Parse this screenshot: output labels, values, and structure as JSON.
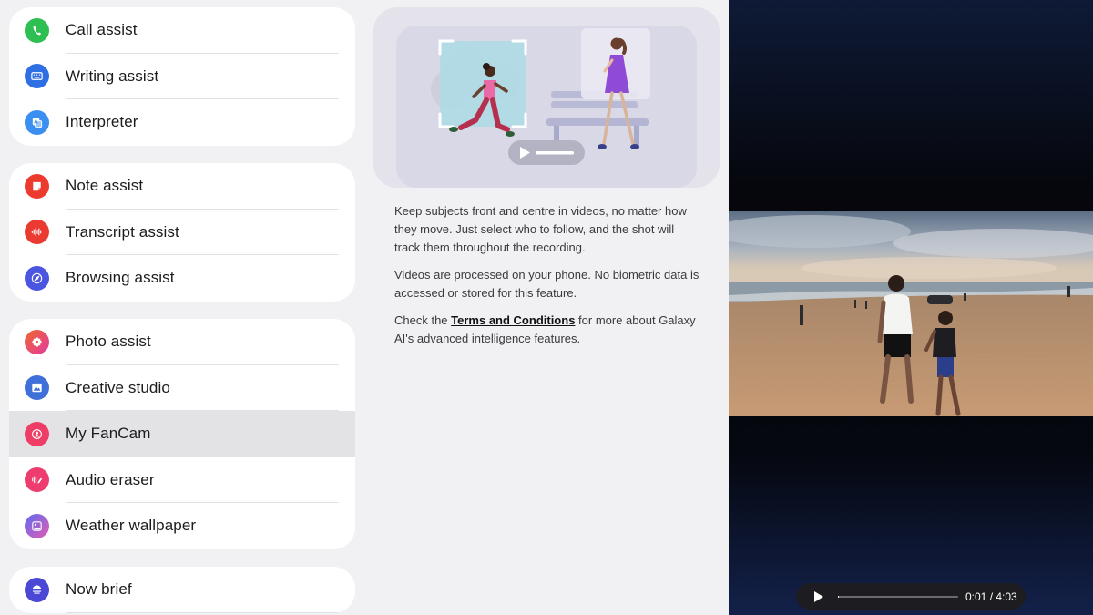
{
  "groups": [
    {
      "items": [
        {
          "label": "Call assist",
          "icon": "phone-icon",
          "color": "#2dbf52"
        },
        {
          "label": "Writing assist",
          "icon": "keyboard-icon",
          "color": "#2f6fe4"
        },
        {
          "label": "Interpreter",
          "icon": "translate-icon",
          "color": "#3b8ff0"
        }
      ]
    },
    {
      "items": [
        {
          "label": "Note assist",
          "icon": "note-icon",
          "color": "#ec3a2e"
        },
        {
          "label": "Transcript assist",
          "icon": "waveform-icon",
          "color": "#ea3b33"
        },
        {
          "label": "Browsing assist",
          "icon": "compass-icon",
          "color": "#4b56e0"
        }
      ]
    },
    {
      "items": [
        {
          "label": "Photo assist",
          "icon": "flower-icon",
          "color": "#e7398f"
        },
        {
          "label": "Creative studio",
          "icon": "canvas-icon",
          "color": "#3f6fd8"
        },
        {
          "label": "My FanCam",
          "icon": "person-focus-icon",
          "color": "#ee3e66",
          "selected": true
        },
        {
          "label": "Audio eraser",
          "icon": "audio-erase-icon",
          "color": "#ed3d6e"
        },
        {
          "label": "Weather wallpaper",
          "icon": "wallpaper-icon",
          "color": "#8e63e8"
        }
      ]
    },
    {
      "items": [
        {
          "label": "Now brief",
          "icon": "brief-icon",
          "color": "#4b48d6"
        }
      ]
    }
  ],
  "detail": {
    "para1": "Keep subjects front and centre in videos, no matter how they move. Just select who to follow, and the shot will track them throughout the recording.",
    "para2": "Videos are processed on your phone. No biometric data is accessed or stored for this feature.",
    "para3_prefix": "Check the ",
    "para3_link": "Terms and Conditions",
    "para3_suffix": " for more about Galaxy AI's advanced intelligence features."
  },
  "video": {
    "time": "0:01 / 4:03",
    "progress": 0.004
  }
}
